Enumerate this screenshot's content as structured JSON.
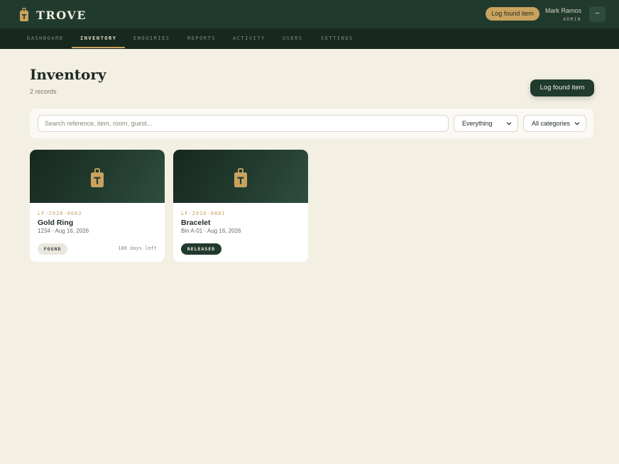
{
  "app": {
    "name": "TROVE",
    "icon": "luggage-tag-icon"
  },
  "header": {
    "log_button": "Log found item",
    "user": {
      "name": "Mark Ramos",
      "role": "ADMIN"
    },
    "menu_button": "–"
  },
  "nav": {
    "items": [
      {
        "label": "DASHBOARD",
        "active": false
      },
      {
        "label": "INVENTORY",
        "active": true
      },
      {
        "label": "ENQUIRIES",
        "active": false
      },
      {
        "label": "REPORTS",
        "active": false
      },
      {
        "label": "ACTIVITY",
        "active": false
      },
      {
        "label": "USERS",
        "active": false
      },
      {
        "label": "SETTINGS",
        "active": false
      }
    ]
  },
  "main": {
    "title": "Inventory",
    "count": "2 records",
    "log_button": "Log found item"
  },
  "filters": {
    "search": {
      "placeholder": "Search reference, item, room, guest...",
      "value": ""
    },
    "type": {
      "selected": "Everything"
    },
    "category": {
      "selected": "All categories"
    }
  },
  "items": [
    {
      "ref": "LF-2026-0002",
      "name": "Gold Ring",
      "meta": "1234 · Aug 16, 2026",
      "status": "FOUND",
      "days_left": "180 days left"
    },
    {
      "ref": "LF-2026-0001",
      "name": "Bracelet",
      "meta": "Bin A-01 · Aug 16, 2026",
      "status": "RELEASED"
    }
  ],
  "colors": {
    "page_bg": "#f3efe3",
    "header_bg": "#213a2e",
    "nav_bg": "#17291f",
    "accent_gold": "#c9a35e",
    "card_bg": "#ffffff"
  }
}
